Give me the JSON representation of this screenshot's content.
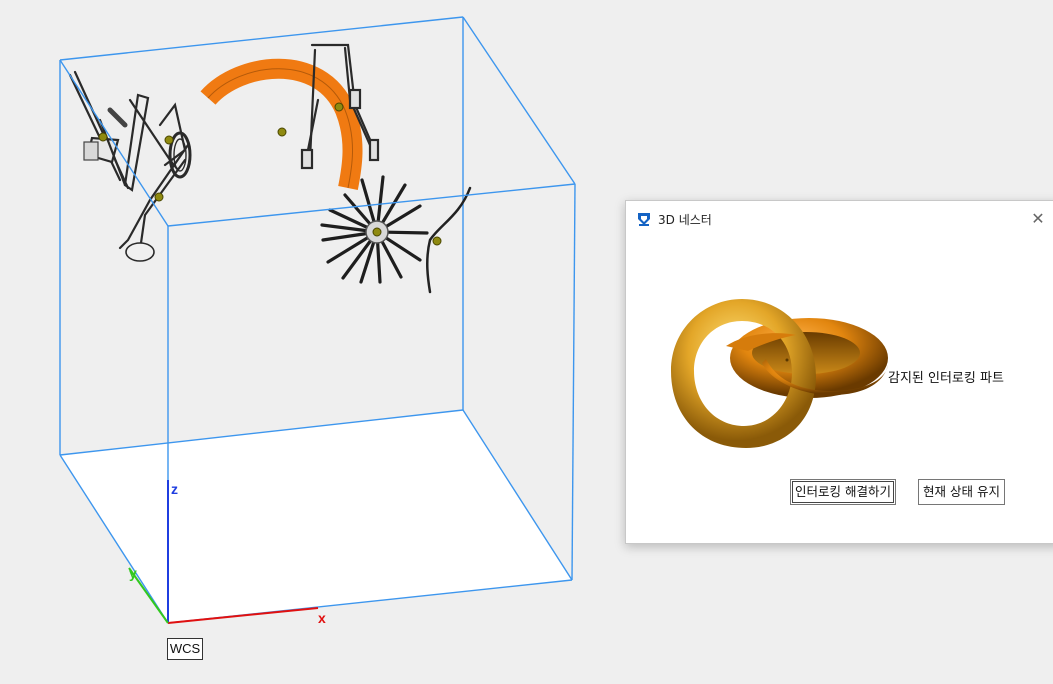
{
  "viewport": {
    "coordinate_system_label": "WCS",
    "axes": {
      "x": "x",
      "y": "y",
      "z": "z"
    },
    "colors": {
      "bounding_box": "#3d96ee",
      "x_axis": "#e01010",
      "y_axis": "#32c81e",
      "z_axis": "#1f3ee0",
      "highlight_part": "#f07a12"
    }
  },
  "dialog": {
    "title": "3D 네스터",
    "close_icon": "close-icon",
    "detected_label": "감지된 인터로킹 파트",
    "buttons": {
      "resolve": "인터로킹 해결하기",
      "keep": "현재 상태 유지"
    }
  }
}
